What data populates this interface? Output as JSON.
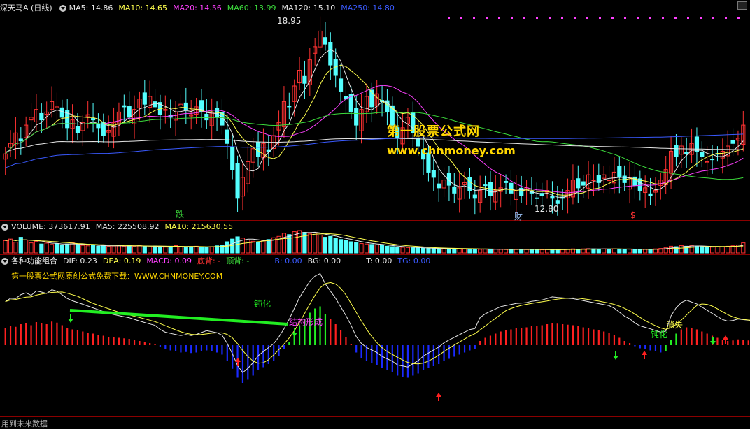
{
  "price_panel": {
    "name": "深天马A",
    "period": "(日线)",
    "ma": [
      {
        "label": "MA5: 14.86",
        "color": "#e6e6e6"
      },
      {
        "label": "MA10: 14.65",
        "color": "#ffff4d"
      },
      {
        "label": "MA20: 14.56",
        "color": "#ff40ff"
      },
      {
        "label": "MA60: 13.99",
        "color": "#3cdc3c"
      },
      {
        "label": "MA120: 15.10",
        "color": "#e6e6e6"
      },
      {
        "label": "MA250: 14.80",
        "color": "#3a5aff"
      }
    ],
    "high_label": "18.95",
    "low_label": "12.80",
    "event_markers": [
      "跌",
      "财",
      "$"
    ]
  },
  "watermark": {
    "title": "第一股票公式网",
    "url": "www.chnmoney.com"
  },
  "volume_panel": {
    "title": "VOLUME: 373617.91",
    "ma5": "MA5: 225508.92",
    "ma10": "MA10: 215630.55"
  },
  "indicator_panel": {
    "title": "各种功能组合",
    "dif": "DIF: 0.23",
    "dea": "DEA: 0.19",
    "macd": "MACD: 0.09",
    "bottom_div": "底背: -",
    "top_div": "顶背: -",
    "b": "B: 0.00",
    "bg": "BG: 0.00",
    "t": "T: 0.00",
    "tg": "TG: 0.00",
    "promo": "第一股票公式网原创公式免费下载：WWW.CHNMONEY.COM",
    "annotations": [
      "钝化",
      "结构形成",
      "消失",
      "钝化"
    ]
  },
  "footer": "用到未来数据",
  "colors": {
    "up": "#ff3232",
    "down": "#54ffff",
    "macd_pos": "#ff2020",
    "macd_neg": "#1a2aff",
    "divider": "#8b0000",
    "highlight_green": "#22ee22"
  },
  "chart_data": [
    {
      "type": "candlestick",
      "title": "深天马A (日线)",
      "closes": [
        14.2,
        14.6,
        15.0,
        14.7,
        15.3,
        15.6,
        15.9,
        15.5,
        15.8,
        16.2,
        16.0,
        15.6,
        15.2,
        15.5,
        15.0,
        15.4,
        15.7,
        15.5,
        15.2,
        14.9,
        15.1,
        15.4,
        15.8,
        16.0,
        15.6,
        15.9,
        16.3,
        16.1,
        16.4,
        16.0,
        15.7,
        15.9,
        15.6,
        15.8,
        16.1,
        15.9,
        15.7,
        16.0,
        15.8,
        15.5,
        15.8,
        15.6,
        15.3,
        14.6,
        13.6,
        12.5,
        13.3,
        13.9,
        14.4,
        14.1,
        14.6,
        14.3,
        14.9,
        15.4,
        16.2,
        16.0,
        16.8,
        17.4,
        16.9,
        17.8,
        18.3,
        18.9,
        18.4,
        17.6,
        17.2,
        16.6,
        16.3,
        15.8,
        15.3,
        15.9,
        16.4,
        16.0,
        16.5,
        16.2,
        15.8,
        15.3,
        14.8,
        15.2,
        15.6,
        15.0,
        14.5,
        14.0,
        13.5,
        13.3,
        12.9,
        13.2,
        13.0,
        12.7,
        12.9,
        13.1,
        12.8,
        12.5,
        12.8,
        13.0,
        12.6,
        12.8,
        12.9,
        13.1,
        12.7,
        12.8,
        12.6,
        12.9,
        12.7,
        12.5,
        12.6,
        12.8,
        12.5,
        12.3,
        12.5,
        12.8,
        13.2,
        12.9,
        13.0,
        13.4,
        13.2,
        13.1,
        13.4,
        13.2,
        13.5,
        13.3,
        13.1,
        13.3,
        13.0,
        12.8,
        12.9,
        12.6,
        12.8,
        13.2,
        13.6,
        14.3,
        14.1,
        14.5,
        14.2,
        14.6,
        14.3,
        14.1,
        13.9,
        14.0,
        14.2,
        14.3,
        14.5,
        14.6,
        14.8,
        15.3
      ],
      "ma_lines": [
        "MA5",
        "MA10",
        "MA20",
        "MA60",
        "MA120",
        "MA250"
      ],
      "annotations": [
        "18.95",
        "12.80"
      ]
    },
    {
      "type": "bar",
      "title": "VOLUME: 373617.91",
      "series": [
        {
          "name": "MA5",
          "values": []
        },
        {
          "name": "MA10",
          "values": []
        }
      ],
      "values": [
        0.55,
        0.62,
        0.48,
        0.7,
        0.58,
        0.45,
        0.52,
        0.4,
        0.44,
        0.38,
        0.42,
        0.35,
        0.4,
        0.46,
        0.38,
        0.34,
        0.32,
        0.36,
        0.3,
        0.33,
        0.29,
        0.31,
        0.35,
        0.3,
        0.34,
        0.28,
        0.33,
        0.3,
        0.27,
        0.31,
        0.29,
        0.26,
        0.3,
        0.33,
        0.28,
        0.25,
        0.27,
        0.3,
        0.26,
        0.24,
        0.28,
        0.32,
        0.35,
        0.5,
        0.62,
        0.72,
        0.66,
        0.58,
        0.52,
        0.48,
        0.56,
        0.6,
        0.68,
        0.74,
        0.88,
        0.82,
        0.95,
        1.0,
        0.92,
        0.85,
        0.9,
        0.8,
        0.7,
        0.74,
        0.66,
        0.6,
        0.55,
        0.5,
        0.46,
        0.42,
        0.4,
        0.38,
        0.36,
        0.34,
        0.3,
        0.28,
        0.26,
        0.25,
        0.24,
        0.23,
        0.22,
        0.21,
        0.2,
        0.2,
        0.19,
        0.2,
        0.18,
        0.19,
        0.18,
        0.17,
        0.18,
        0.17,
        0.16,
        0.17,
        0.16,
        0.17,
        0.16,
        0.15,
        0.16,
        0.15,
        0.16,
        0.15,
        0.16,
        0.15,
        0.14,
        0.15,
        0.14,
        0.15,
        0.16,
        0.17,
        0.18,
        0.17,
        0.18,
        0.19,
        0.18,
        0.17,
        0.18,
        0.17,
        0.18,
        0.17,
        0.16,
        0.17,
        0.16,
        0.15,
        0.16,
        0.17,
        0.18,
        0.2,
        0.24,
        0.3,
        0.28,
        0.33,
        0.3,
        0.34,
        0.31,
        0.28,
        0.27,
        0.26,
        0.28,
        0.27,
        0.3,
        0.32,
        0.36,
        0.45
      ]
    },
    {
      "type": "bar",
      "title": "各种功能组合 MACD",
      "series": [
        {
          "name": "DIF",
          "values": []
        },
        {
          "name": "DEA",
          "values": []
        }
      ],
      "values": [
        0.32,
        0.36,
        0.35,
        0.4,
        0.42,
        0.38,
        0.44,
        0.42,
        0.4,
        0.45,
        0.43,
        0.38,
        0.33,
        0.3,
        0.28,
        0.26,
        0.24,
        0.22,
        0.2,
        0.18,
        0.16,
        0.15,
        0.14,
        0.13,
        0.12,
        0.1,
        0.08,
        0.06,
        0.04,
        0.02,
        -0.04,
        -0.08,
        -0.1,
        -0.12,
        -0.14,
        -0.13,
        -0.15,
        -0.14,
        -0.12,
        -0.1,
        -0.12,
        -0.14,
        -0.18,
        -0.3,
        -0.45,
        -0.62,
        -0.72,
        -0.66,
        -0.58,
        -0.48,
        -0.42,
        -0.36,
        -0.3,
        -0.2,
        -0.08,
        0.06,
        0.22,
        0.38,
        0.5,
        0.62,
        0.7,
        0.74,
        0.6,
        0.5,
        0.4,
        0.28,
        0.16,
        0.02,
        -0.14,
        -0.24,
        -0.3,
        -0.34,
        -0.38,
        -0.44,
        -0.48,
        -0.52,
        -0.58,
        -0.6,
        -0.62,
        -0.58,
        -0.54,
        -0.48,
        -0.44,
        -0.4,
        -0.36,
        -0.3,
        -0.26,
        -0.22,
        -0.18,
        -0.14,
        -0.1,
        -0.08,
        0.08,
        0.14,
        0.18,
        0.22,
        0.26,
        0.28,
        0.3,
        0.32,
        0.33,
        0.34,
        0.36,
        0.37,
        0.38,
        0.4,
        0.42,
        0.41,
        0.4,
        0.39,
        0.38,
        0.36,
        0.34,
        0.32,
        0.3,
        0.28,
        0.26,
        0.24,
        0.2,
        0.14,
        0.08,
        0.04,
        -0.02,
        -0.06,
        -0.08,
        -0.1,
        -0.12,
        -0.14,
        -0.12,
        0.1,
        0.22,
        0.3,
        0.34,
        0.32,
        0.3,
        0.26,
        0.22,
        0.18,
        0.14,
        0.1,
        0.08,
        0.09,
        0.11,
        0.1,
        0.09,
        0.08,
        0.1,
        0.09,
        0.09
      ]
    }
  ]
}
